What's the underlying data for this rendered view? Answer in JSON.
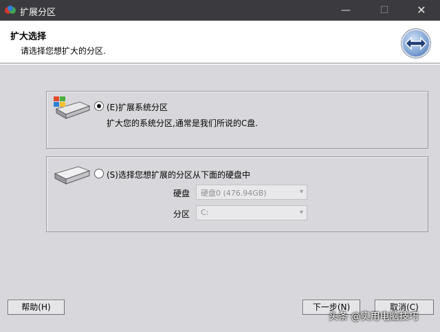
{
  "window": {
    "title": "扩展分区",
    "min_glyph": "—",
    "max_glyph": "☐",
    "close_glyph": "✕"
  },
  "header": {
    "title": "扩大选择",
    "subtitle": "请选择您想扩大的分区."
  },
  "options": {
    "system": {
      "label": "(E)扩展系统分区",
      "description": "扩大您的系统分区,通常是我们所说的C盘.",
      "selected": true
    },
    "custom": {
      "label": "(S)选择您想扩展的分区从下面的硬盘中",
      "selected": false,
      "disk_label": "硬盘",
      "disk_value": "硬盘0 (476.94GB)",
      "partition_label": "分区",
      "partition_value": "C:"
    }
  },
  "buttons": {
    "help": "帮助(H)",
    "next": "下一步(N)",
    "cancel": "取消(C)"
  },
  "watermark": "头条 @实用电脑技巧",
  "colors": {
    "titlebar": "#3b3b3f",
    "body": "#d8d8dc",
    "header": "#ffffff"
  }
}
